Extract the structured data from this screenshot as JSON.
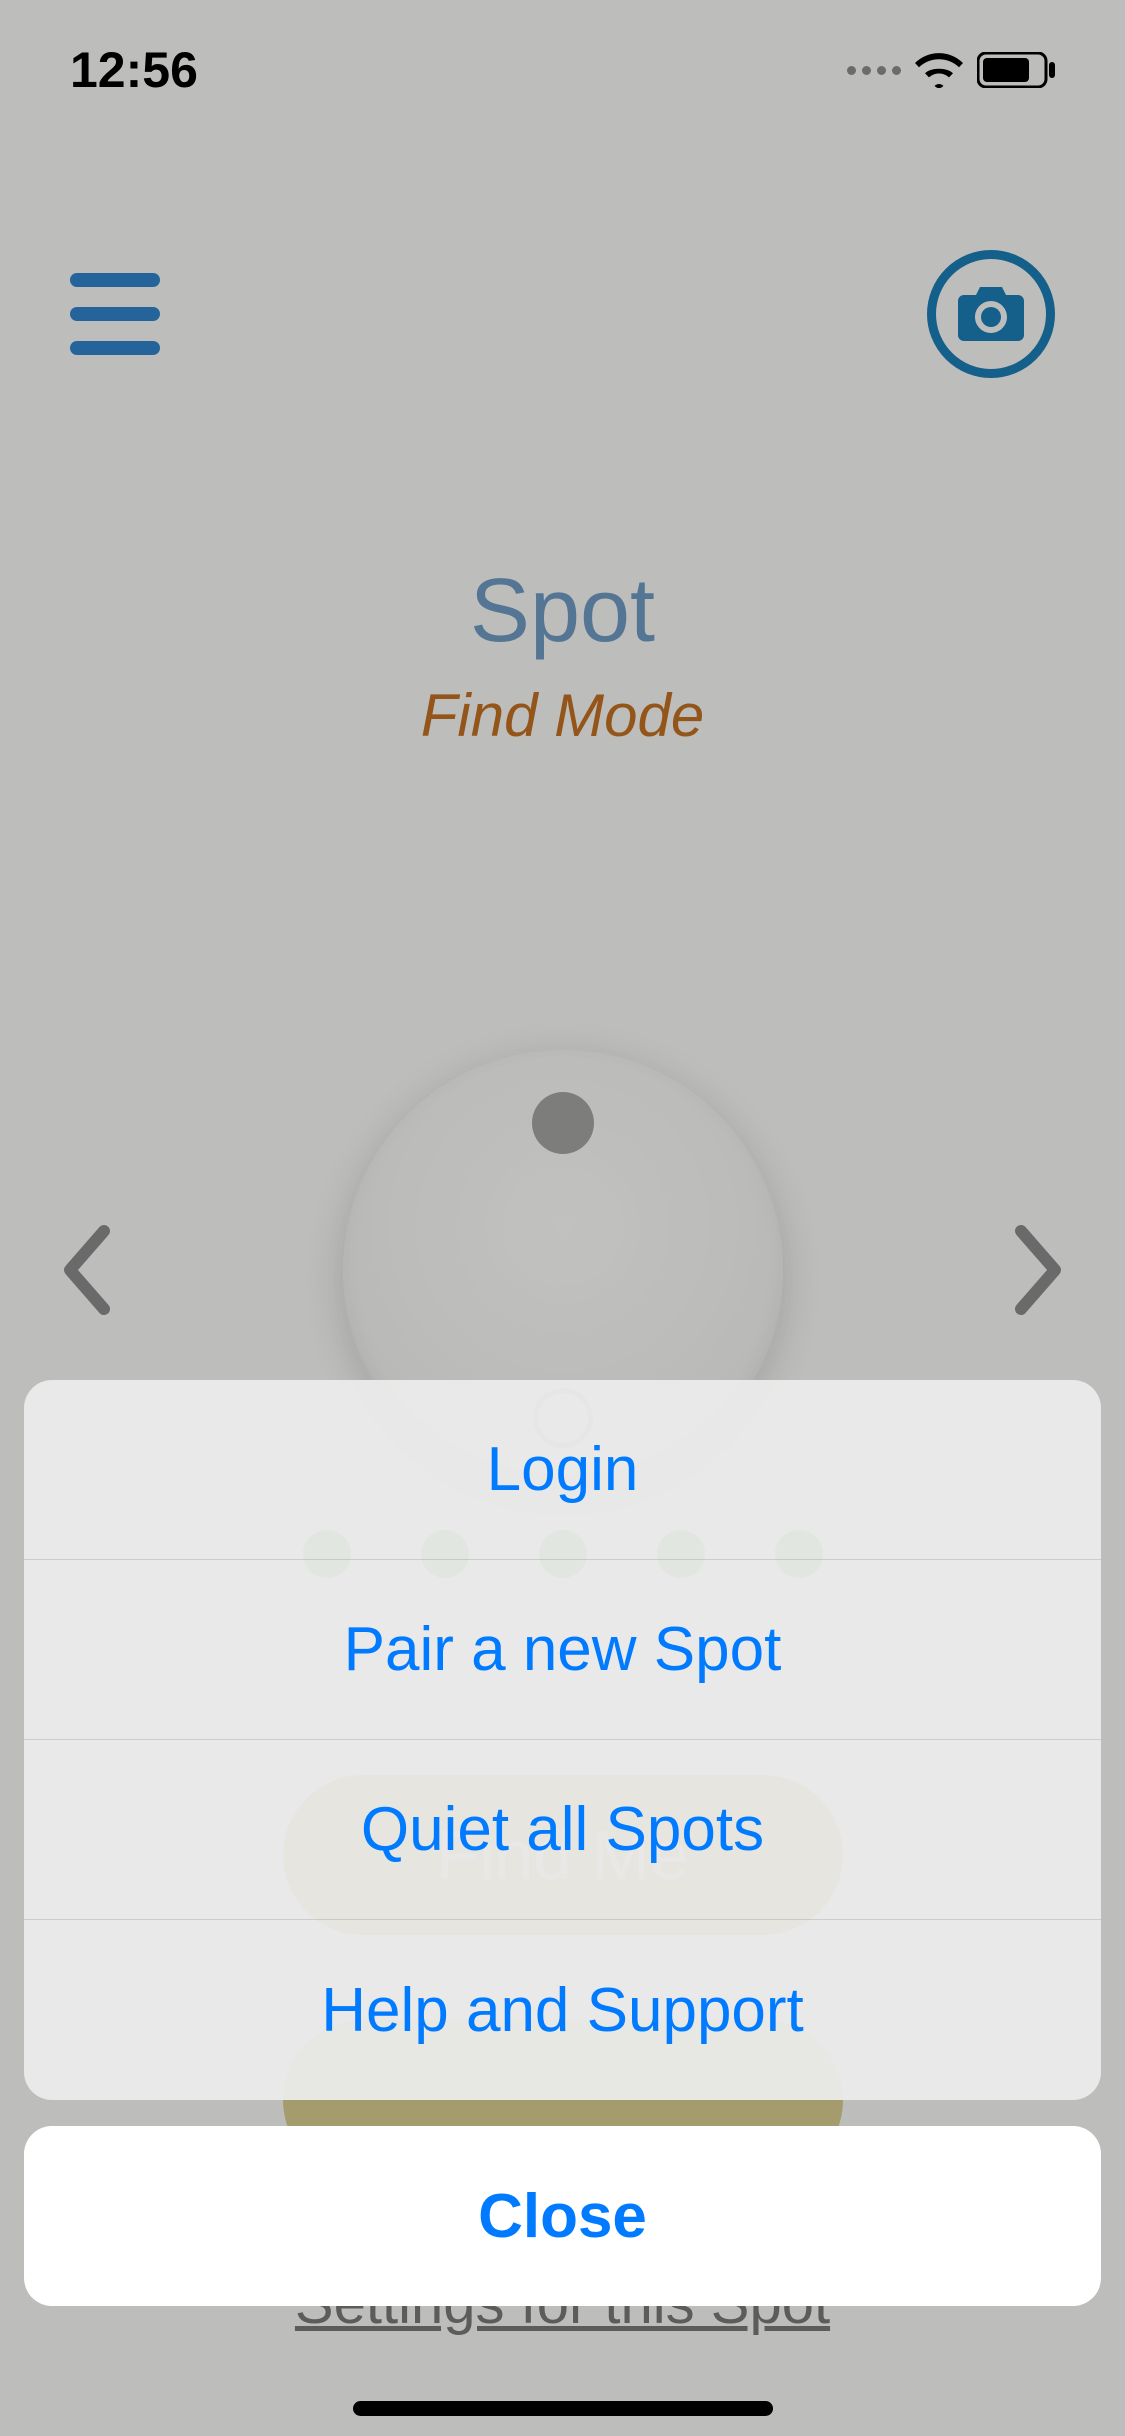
{
  "status": {
    "time": "12:56"
  },
  "header": {
    "device_title": "Spot",
    "mode_subtitle": "Find Mode"
  },
  "buttons": {
    "find_me": "Find Me",
    "settings_link": "Settings for this Spot"
  },
  "signal": {
    "strength_bars": 5
  },
  "action_sheet": {
    "items": [
      {
        "label": "Login"
      },
      {
        "label": "Pair a new Spot"
      },
      {
        "label": "Quiet all Spots"
      },
      {
        "label": "Help and Support"
      }
    ],
    "cancel": "Close"
  }
}
